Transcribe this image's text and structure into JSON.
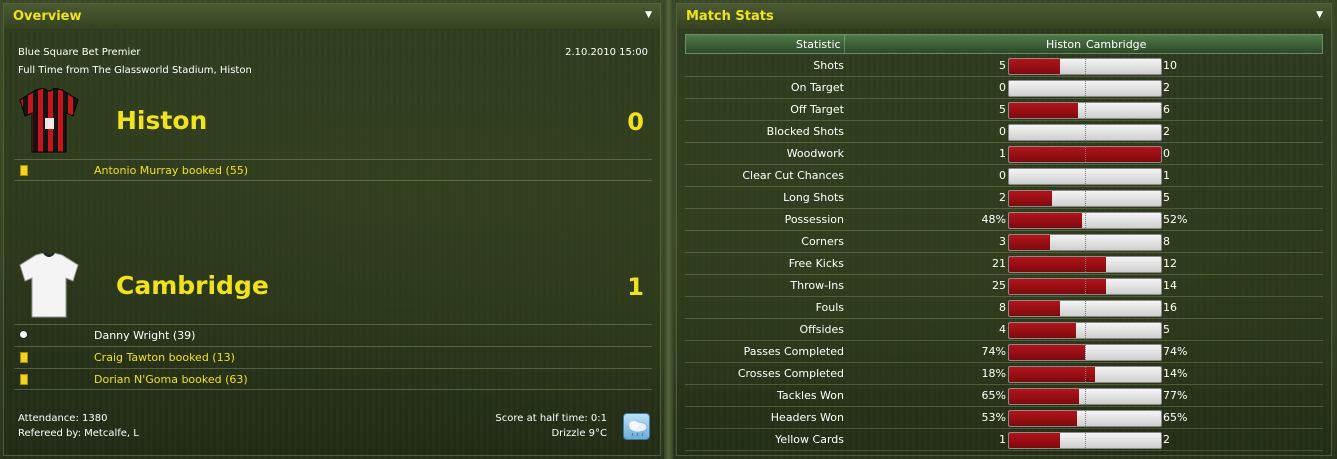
{
  "colors": {
    "accent": "#f0e21c",
    "home_bar": "#9c0f14",
    "away_bar": "#e0e0e0"
  },
  "overview": {
    "title": "Overview",
    "menu_icon": "triangle-down-icon",
    "competition": "Blue Square Bet Premier",
    "datetime": "2.10.2010 15:00",
    "venue_line": "Full Time from The Glassworld Stadium, Histon",
    "home": {
      "name": "Histon",
      "score": "0",
      "shirt": "red-black-striped-shirt-icon",
      "events": [
        {
          "icon": "yellow-card-icon",
          "text": "Antonio Murray booked (55)",
          "style": "yellow"
        }
      ]
    },
    "away": {
      "name": "Cambridge",
      "score": "1",
      "shirt": "white-shirt-icon",
      "events": [
        {
          "icon": "ball-icon",
          "text": "Danny Wright (39)",
          "style": "white"
        },
        {
          "icon": "yellow-card-icon",
          "text": "Craig Tawton booked (13)",
          "style": "yellow"
        },
        {
          "icon": "yellow-card-icon",
          "text": "Dorian N'Goma booked (63)",
          "style": "yellow"
        }
      ]
    },
    "attendance": "Attendance: 1380",
    "referee": "Refereed by: Metcalfe, L",
    "half_time": "Score at half time: 0:1",
    "weather": "Drizzle 9°C",
    "weather_icon": "drizzle-cloud-icon"
  },
  "stats": {
    "title": "Match Stats",
    "menu_icon": "triangle-down-icon",
    "headers": {
      "statistic": "Statistic",
      "home": "Histon",
      "away": "Cambridge"
    },
    "rows": [
      {
        "label": "Shots",
        "home": "5",
        "away": "10",
        "home_share": 0.333
      },
      {
        "label": "On Target",
        "home": "0",
        "away": "2",
        "home_share": 0.0
      },
      {
        "label": "Off Target",
        "home": "5",
        "away": "6",
        "home_share": 0.455
      },
      {
        "label": "Blocked Shots",
        "home": "0",
        "away": "2",
        "home_share": 0.0
      },
      {
        "label": "Woodwork",
        "home": "1",
        "away": "0",
        "home_share": 1.0
      },
      {
        "label": "Clear Cut Chances",
        "home": "0",
        "away": "1",
        "home_share": 0.0
      },
      {
        "label": "Long Shots",
        "home": "2",
        "away": "5",
        "home_share": 0.286
      },
      {
        "label": "Possession",
        "home": "48%",
        "away": "52%",
        "home_share": 0.48
      },
      {
        "label": "Corners",
        "home": "3",
        "away": "8",
        "home_share": 0.273
      },
      {
        "label": "Free Kicks",
        "home": "21",
        "away": "12",
        "home_share": 0.636
      },
      {
        "label": "Throw-Ins",
        "home": "25",
        "away": "14",
        "home_share": 0.641
      },
      {
        "label": "Fouls",
        "home": "8",
        "away": "16",
        "home_share": 0.333
      },
      {
        "label": "Offsides",
        "home": "4",
        "away": "5",
        "home_share": 0.444
      },
      {
        "label": "Passes Completed",
        "home": "74%",
        "away": "74%",
        "home_share": 0.5
      },
      {
        "label": "Crosses Completed",
        "home": "18%",
        "away": "14%",
        "home_share": 0.563
      },
      {
        "label": "Tackles Won",
        "home": "65%",
        "away": "77%",
        "home_share": 0.458
      },
      {
        "label": "Headers Won",
        "home": "53%",
        "away": "65%",
        "home_share": 0.449
      },
      {
        "label": "Yellow Cards",
        "home": "1",
        "away": "2",
        "home_share": 0.333
      }
    ]
  }
}
